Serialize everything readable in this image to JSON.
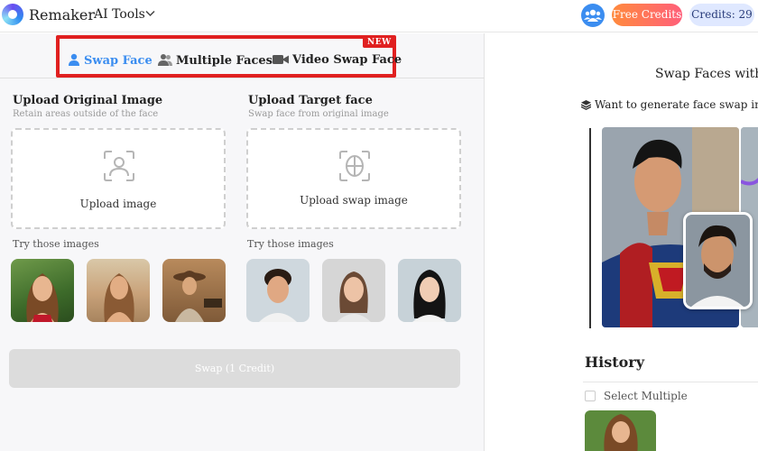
{
  "header": {
    "brand": "Remaker",
    "menu_label": "AI Tools",
    "free_credits_label": "Free Credits",
    "credits_label": "Credits: 29"
  },
  "tabs": [
    {
      "label": "Swap Face",
      "icon": "user-icon",
      "active": true
    },
    {
      "label": "Multiple Faces",
      "icon": "users-icon",
      "active": false
    },
    {
      "label": "Video Swap Face",
      "icon": "video-icon",
      "active": false
    }
  ],
  "new_badge": "NEW",
  "upload_original": {
    "title": "Upload Original Image",
    "subtitle": "Retain areas outside of the face",
    "button_label": "Upload image"
  },
  "upload_target": {
    "title": "Upload Target face",
    "subtitle": "Swap face from original image",
    "button_label": "Upload swap image"
  },
  "try_label": "Try those images",
  "swap_button_label": "Swap (1 Credit)",
  "right_panel": {
    "title": "Swap Faces with C",
    "promo_text": "Want to generate face swap images in",
    "history_label": "History",
    "select_multiple_label": "Select Multiple"
  },
  "colors": {
    "accent": "#3b8df0",
    "highlight": "#e02020",
    "free_credits_start": "#ff8a3d",
    "free_credits_end": "#ff5f7a",
    "credits_bg": "#dfe8ff"
  }
}
